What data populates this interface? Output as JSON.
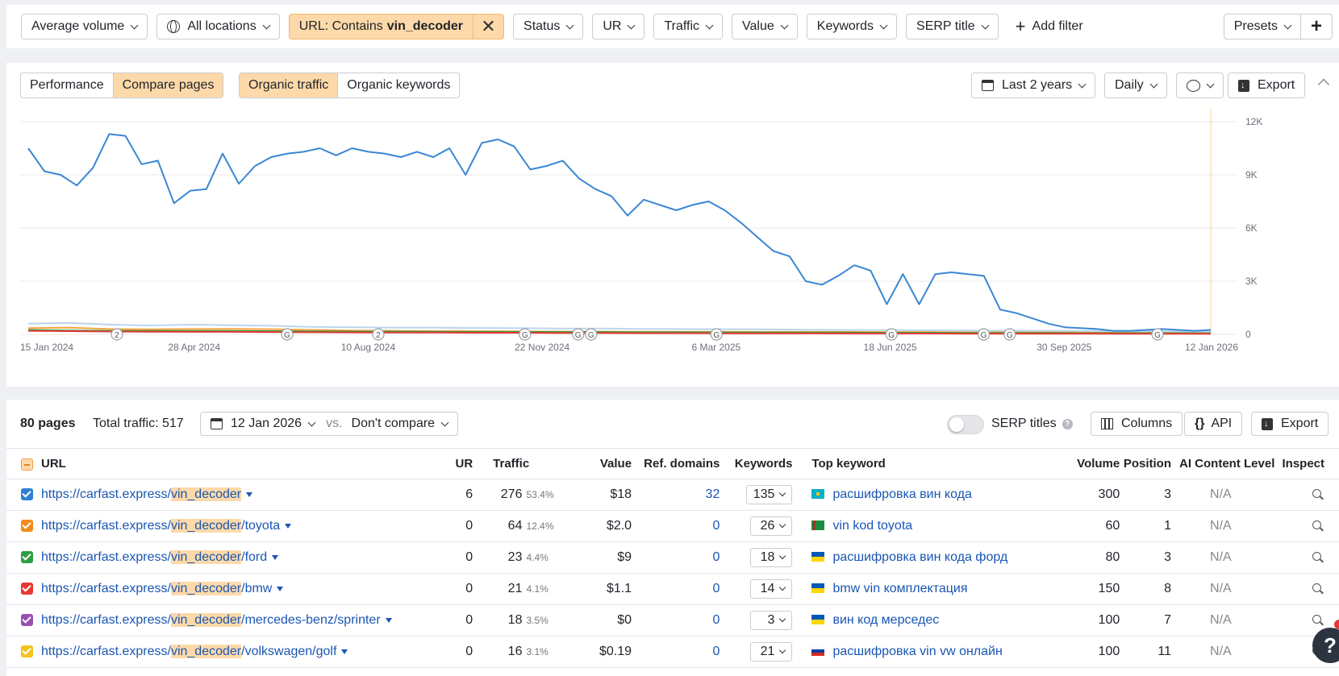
{
  "filters": {
    "avg_volume": "Average volume",
    "locations": "All locations",
    "url_prefix": "URL: Contains",
    "url_value": "vin_decoder",
    "status": "Status",
    "ur": "UR",
    "traffic": "Traffic",
    "value": "Value",
    "keywords": "Keywords",
    "serp_title": "SERP title",
    "add_filter": "Add filter",
    "presets": "Presets"
  },
  "chart_toolbar": {
    "performance": "Performance",
    "compare_pages": "Compare pages",
    "organic_traffic": "Organic traffic",
    "organic_keywords": "Organic keywords",
    "range": "Last 2 years",
    "interval": "Daily",
    "export": "Export"
  },
  "chart_data": {
    "type": "line",
    "x_labels": [
      "15 Jan 2024",
      "28 Apr 2024",
      "10 Aug 2024",
      "22 Nov 2024",
      "6 Mar 2025",
      "18 Jun 2025",
      "30 Sep 2025",
      "12 Jan 2026"
    ],
    "y_ticks": [
      "12K",
      "9K",
      "6K",
      "3K",
      "0"
    ],
    "ylim": [
      0,
      12000
    ],
    "series": [
      {
        "color": "#3b87d4",
        "values": [
          10500,
          9200,
          9000,
          8400,
          9400,
          11300,
          11200,
          9600,
          9800,
          7400,
          8100,
          8200,
          10200,
          8500,
          9500,
          10000,
          10200,
          10300,
          10500,
          10100,
          10500,
          10300,
          10200,
          10000,
          10300,
          10000,
          10500,
          9000,
          10800,
          11000,
          10600,
          9300,
          9500,
          9800,
          8800,
          8200,
          7800,
          6700,
          7600,
          7300,
          7000,
          7300,
          7500,
          7000,
          6300,
          5500,
          4700,
          4400,
          3000,
          2800,
          3300,
          3900,
          3600,
          1700,
          3400,
          1700,
          3400,
          3500,
          3400,
          3300,
          1400,
          1200,
          900,
          600,
          400,
          350,
          300,
          200,
          200,
          250,
          300,
          250,
          200,
          250
        ]
      },
      {
        "color": "#f5a53d",
        "values": [
          350,
          380,
          300,
          280,
          300,
          310,
          290,
          250,
          220,
          200,
          180,
          180,
          170,
          160,
          160,
          150,
          150,
          150,
          140,
          140,
          140,
          130,
          130,
          120,
          120,
          120,
          110,
          100,
          100,
          100
        ]
      },
      {
        "color": "#2e9e48",
        "values": [
          250,
          220,
          200,
          200,
          190,
          190,
          180,
          170,
          160,
          160,
          150,
          140,
          140,
          130,
          130,
          120,
          120,
          110,
          110,
          100,
          100,
          90,
          90,
          80,
          80,
          80,
          70,
          70,
          70,
          60
        ]
      },
      {
        "color": "#e53935",
        "values": [
          200,
          180,
          160,
          150,
          140,
          140,
          130,
          120,
          110,
          100,
          100,
          90,
          90,
          80,
          80,
          70,
          70,
          60,
          60,
          60,
          50,
          50,
          50,
          40,
          40,
          40,
          40,
          30,
          30,
          30
        ]
      },
      {
        "color": "#bcd5ec",
        "values": [
          600,
          650,
          550,
          500,
          550,
          520,
          480,
          420,
          400,
          380,
          380,
          360,
          350,
          330,
          330,
          310,
          300,
          290,
          280,
          260,
          250,
          240,
          230,
          220,
          210,
          200,
          190,
          180,
          170,
          160
        ]
      }
    ],
    "markers": [
      {
        "label": "2",
        "at": 0.075
      },
      {
        "label": "G",
        "at": 0.219
      },
      {
        "label": "2",
        "at": 0.296
      },
      {
        "label": "G",
        "at": 0.42
      },
      {
        "label": "G",
        "at": 0.465
      },
      {
        "label": "G",
        "at": 0.476
      },
      {
        "label": "G",
        "at": 0.582
      },
      {
        "label": "G",
        "at": 0.73
      },
      {
        "label": "G",
        "at": 0.808
      },
      {
        "label": "G",
        "at": 0.83
      },
      {
        "label": "G",
        "at": 0.955
      }
    ]
  },
  "table_toolbar": {
    "pages": "80 pages",
    "total_traffic": "Total traffic: 517",
    "date": "12 Jan 2026",
    "vs": "vs.",
    "compare": "Don't compare",
    "serp_titles": "SERP titles",
    "columns": "Columns",
    "api": "API",
    "export": "Export"
  },
  "table": {
    "headers": {
      "url": "URL",
      "ur": "UR",
      "traffic": "Traffic",
      "value": "Value",
      "ref": "Ref. domains",
      "keywords": "Keywords",
      "top": "Top keyword",
      "volume": "Volume",
      "position": "Position",
      "ai": "AI Content Level",
      "inspect": "Inspect"
    },
    "rows": [
      {
        "color": "#2f80d1",
        "prefix": "https://carfast.express/",
        "hl": "vin_decoder",
        "suffix": "",
        "ur": "6",
        "traffic": "276",
        "pct": "53.4%",
        "value": "$18",
        "ref": "32",
        "kw": "135",
        "flag": "kz",
        "top": "расшифровка вин кода",
        "volume": "300",
        "pos": "3",
        "ai": "N/A"
      },
      {
        "color": "#f08c1c",
        "prefix": "https://carfast.express/",
        "hl": "vin_decoder",
        "suffix": "/toyota",
        "ur": "0",
        "traffic": "64",
        "pct": "12.4%",
        "value": "$2.0",
        "ref": "0",
        "kw": "26",
        "flag": "tm",
        "top": "vin kod toyota",
        "volume": "60",
        "pos": "1",
        "ai": "N/A"
      },
      {
        "color": "#2e9e48",
        "prefix": "https://carfast.express/",
        "hl": "vin_decoder",
        "suffix": "/ford",
        "ur": "0",
        "traffic": "23",
        "pct": "4.4%",
        "value": "$9",
        "ref": "0",
        "kw": "18",
        "flag": "ua",
        "top": "расшифровка вин кода форд",
        "volume": "80",
        "pos": "3",
        "ai": "N/A"
      },
      {
        "color": "#e53935",
        "prefix": "https://carfast.express/",
        "hl": "vin_decoder",
        "suffix": "/bmw",
        "ur": "0",
        "traffic": "21",
        "pct": "4.1%",
        "value": "$1.1",
        "ref": "0",
        "kw": "14",
        "flag": "ua",
        "top": "bmw vin комплектация",
        "volume": "150",
        "pos": "8",
        "ai": "N/A"
      },
      {
        "color": "#9b4fb0",
        "prefix": "https://carfast.express/",
        "hl": "vin_decoder",
        "suffix": "/mercedes-benz/sprinter",
        "ur": "0",
        "traffic": "18",
        "pct": "3.5%",
        "value": "$0",
        "ref": "0",
        "kw": "3",
        "flag": "ua",
        "top": "вин код мерседес",
        "volume": "100",
        "pos": "7",
        "ai": "N/A"
      },
      {
        "color": "#f2c41d",
        "prefix": "https://carfast.express/",
        "hl": "vin_decoder",
        "suffix": "/volkswagen/golf",
        "ur": "0",
        "traffic": "16",
        "pct": "3.1%",
        "value": "$0.19",
        "ref": "0",
        "kw": "21",
        "flag": "ru",
        "top": "расшифровка vin vw онлайн",
        "volume": "100",
        "pos": "11",
        "ai": "N/A"
      }
    ]
  },
  "help": "?"
}
